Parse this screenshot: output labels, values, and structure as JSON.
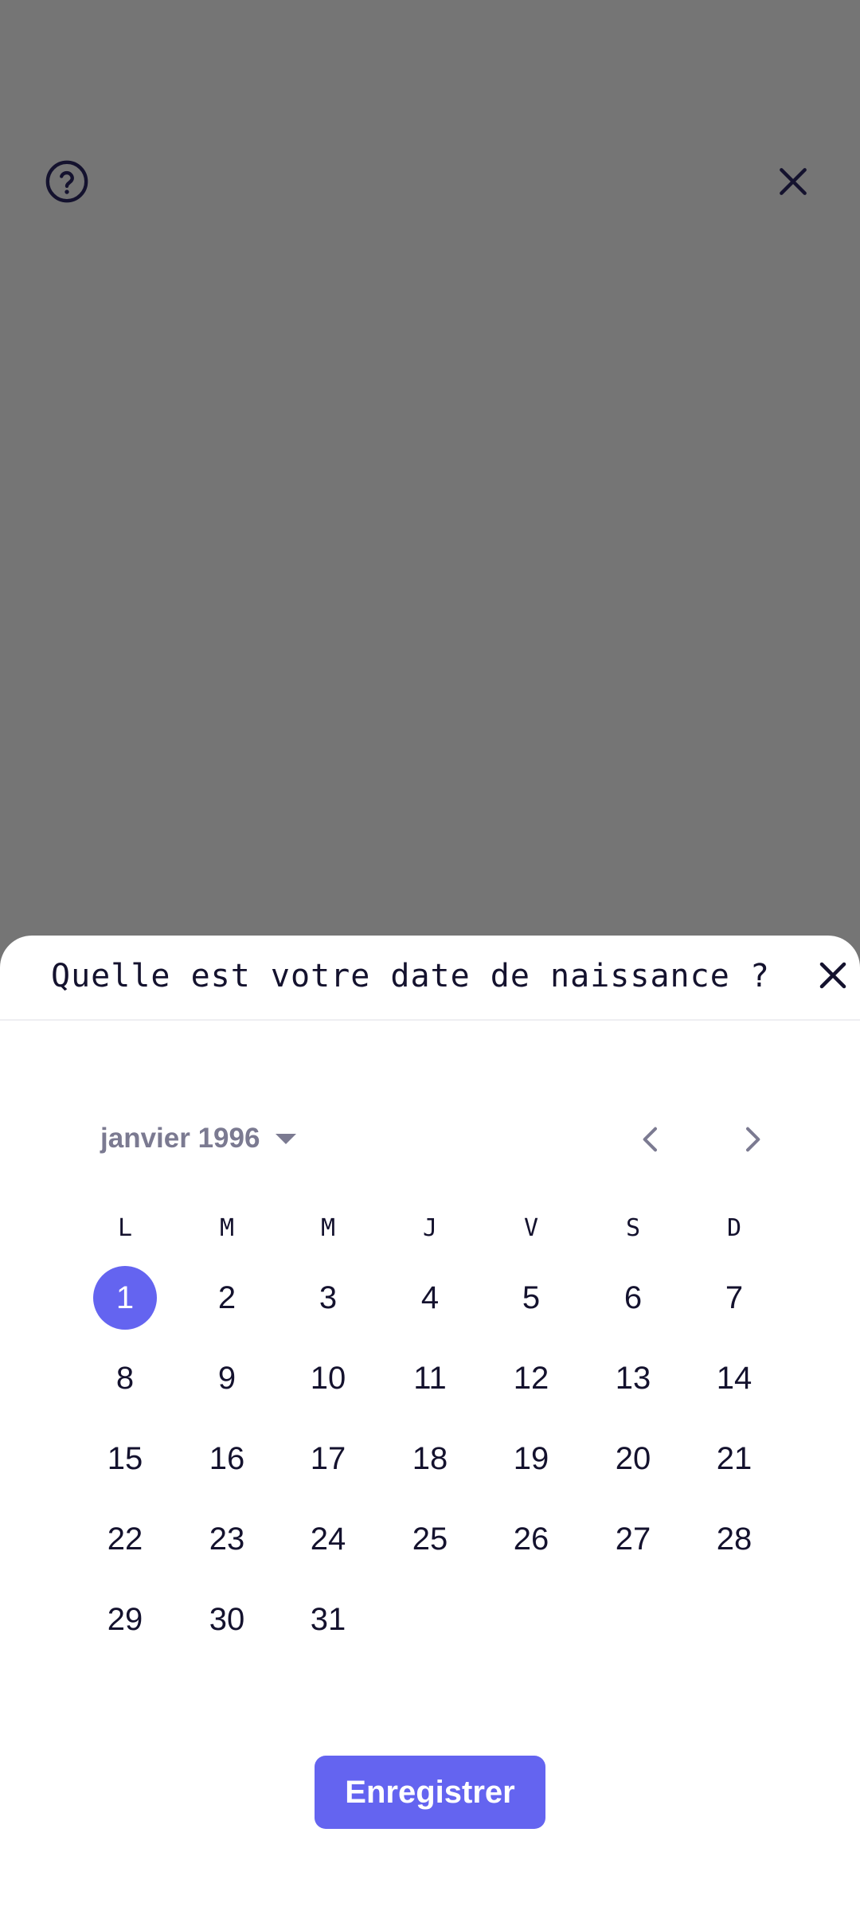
{
  "colors": {
    "accent": "#6464f0",
    "scrim": "#757575",
    "text": "#14122e",
    "muted": "#7b7a91"
  },
  "top_bar": {
    "help_icon": "help-circle-icon",
    "close_icon": "close-icon"
  },
  "sheet": {
    "title": "Quelle est votre date de naissance ?",
    "close_icon": "close-icon"
  },
  "calendar": {
    "month_label": "janvier 1996",
    "month_toggle_icon": "caret-down-icon",
    "prev_icon": "chevron-left-icon",
    "next_icon": "chevron-right-icon",
    "weekdays": [
      "L",
      "M",
      "M",
      "J",
      "V",
      "S",
      "D"
    ],
    "days": [
      "1",
      "2",
      "3",
      "4",
      "5",
      "6",
      "7",
      "8",
      "9",
      "10",
      "11",
      "12",
      "13",
      "14",
      "15",
      "16",
      "17",
      "18",
      "19",
      "20",
      "21",
      "22",
      "23",
      "24",
      "25",
      "26",
      "27",
      "28",
      "29",
      "30",
      "31"
    ],
    "selected_day": "1"
  },
  "save_button": {
    "label": "Enregistrer"
  }
}
